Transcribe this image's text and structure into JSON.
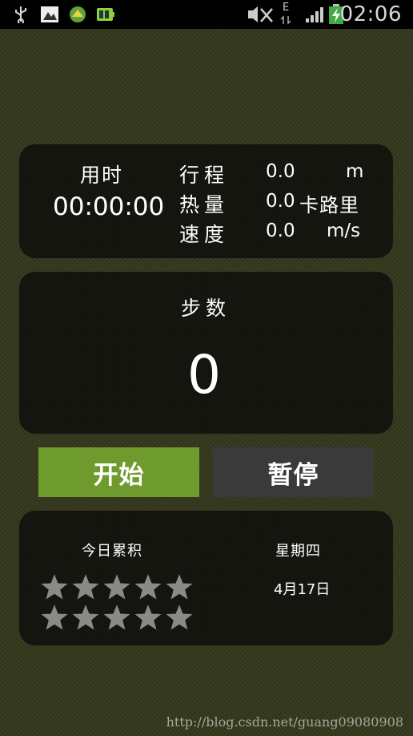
{
  "status_bar": {
    "time": "02:06",
    "network_label": "E",
    "icons": [
      "usb-icon",
      "image-notification-icon",
      "app-notification-icon",
      "battery-app-icon",
      "mute-icon",
      "data-arrows-icon",
      "signal-icon",
      "battery-charging-icon"
    ]
  },
  "stats": {
    "time_label": "用时",
    "time_value": "00:00:00",
    "distance_label": "行程",
    "distance_value": "0.0",
    "distance_unit": "m",
    "calories_label": "热量",
    "calories_value": "0.0",
    "calories_unit": "卡路里",
    "speed_label": "速度",
    "speed_value": "0.0",
    "speed_unit": "m/s"
  },
  "steps": {
    "label": "步数",
    "value": "0"
  },
  "buttons": {
    "start_label": "开始",
    "pause_label": "暂停"
  },
  "today": {
    "label": "今日累积",
    "weekday": "星期四",
    "date": "4月17日",
    "stars_total": 10,
    "stars_filled": 0
  },
  "watermark": "http://blog.csdn.net/guang09080908",
  "colors": {
    "start_button": "#6f9b2e",
    "pause_button": "#3a3a3a"
  }
}
